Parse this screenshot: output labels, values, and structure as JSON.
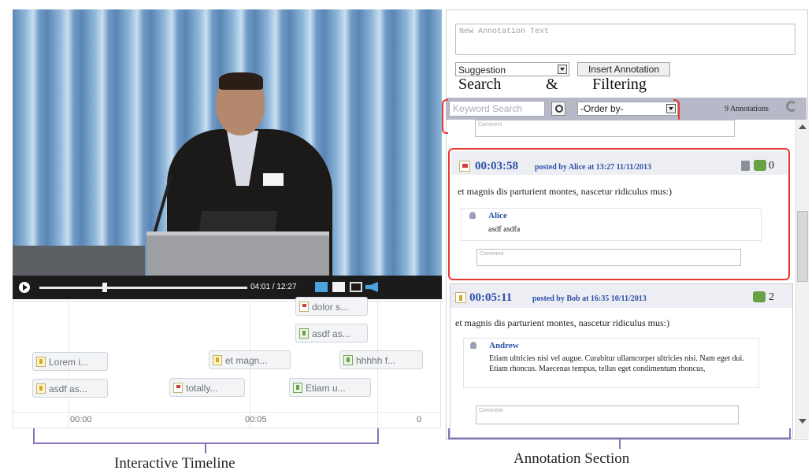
{
  "player": {
    "time_display": "04:01 / 12:27",
    "progress": 0.32
  },
  "timeline": {
    "chips": [
      {
        "type": "flag",
        "label": "dolor s..."
      },
      {
        "type": "question",
        "label": "asdf as..."
      },
      {
        "type": "idea",
        "label": "Lorem i..."
      },
      {
        "type": "idea",
        "label": "et magn..."
      },
      {
        "type": "question",
        "label": "hhhhh f..."
      },
      {
        "type": "idea",
        "label": "asdf as..."
      },
      {
        "type": "flag",
        "label": "totally..."
      },
      {
        "type": "question",
        "label": "Etiam u..."
      }
    ],
    "ticks": [
      "00:00",
      "00:05",
      "0"
    ]
  },
  "captions": {
    "timeline": "Interactive Timeline",
    "annotations": "Annotation Section",
    "search": "Search",
    "amp": "&",
    "filtering": "Filtering"
  },
  "composer": {
    "placeholder": "New Annotation Text",
    "type_selected": "Suggestion",
    "insert_label": "Insert Annotation"
  },
  "filterbar": {
    "search_placeholder": "Keyword Search",
    "order_selected": "-Order by-",
    "count_label": "9 Annotations"
  },
  "annotations": [
    {
      "time": "00:03:58",
      "meta": "posted by Alice at 13:27  11/11/2013",
      "text": "et magnis dis parturient montes, nascetur ridiculus mus:)",
      "reply_count": "0",
      "replies": [
        {
          "author": "Alice",
          "text": "asdf asdfa"
        }
      ],
      "comment_placeholder": "Comment"
    },
    {
      "time": "00:05:11",
      "meta": "posted by Bob at 16:35  10/11/2013",
      "text": "et magnis dis parturient montes, nascetur ridiculus mus:)",
      "reply_count": "2",
      "replies": [
        {
          "author": "Andrew",
          "text": "Etiam ultricies nisi vel augue. Curabitur ullamcorper ultricies nisi. Nam eget dui. Etiam rhoncus. Maecenas tempus, tellus eget condimentum rhoncus,"
        }
      ],
      "comment_placeholder": "Comment"
    }
  ],
  "top_comment_placeholder": "Comment",
  "colors": {
    "highlight": "#e53935",
    "bracket": "#8a72b8",
    "link_blue": "#2e4fa8"
  }
}
